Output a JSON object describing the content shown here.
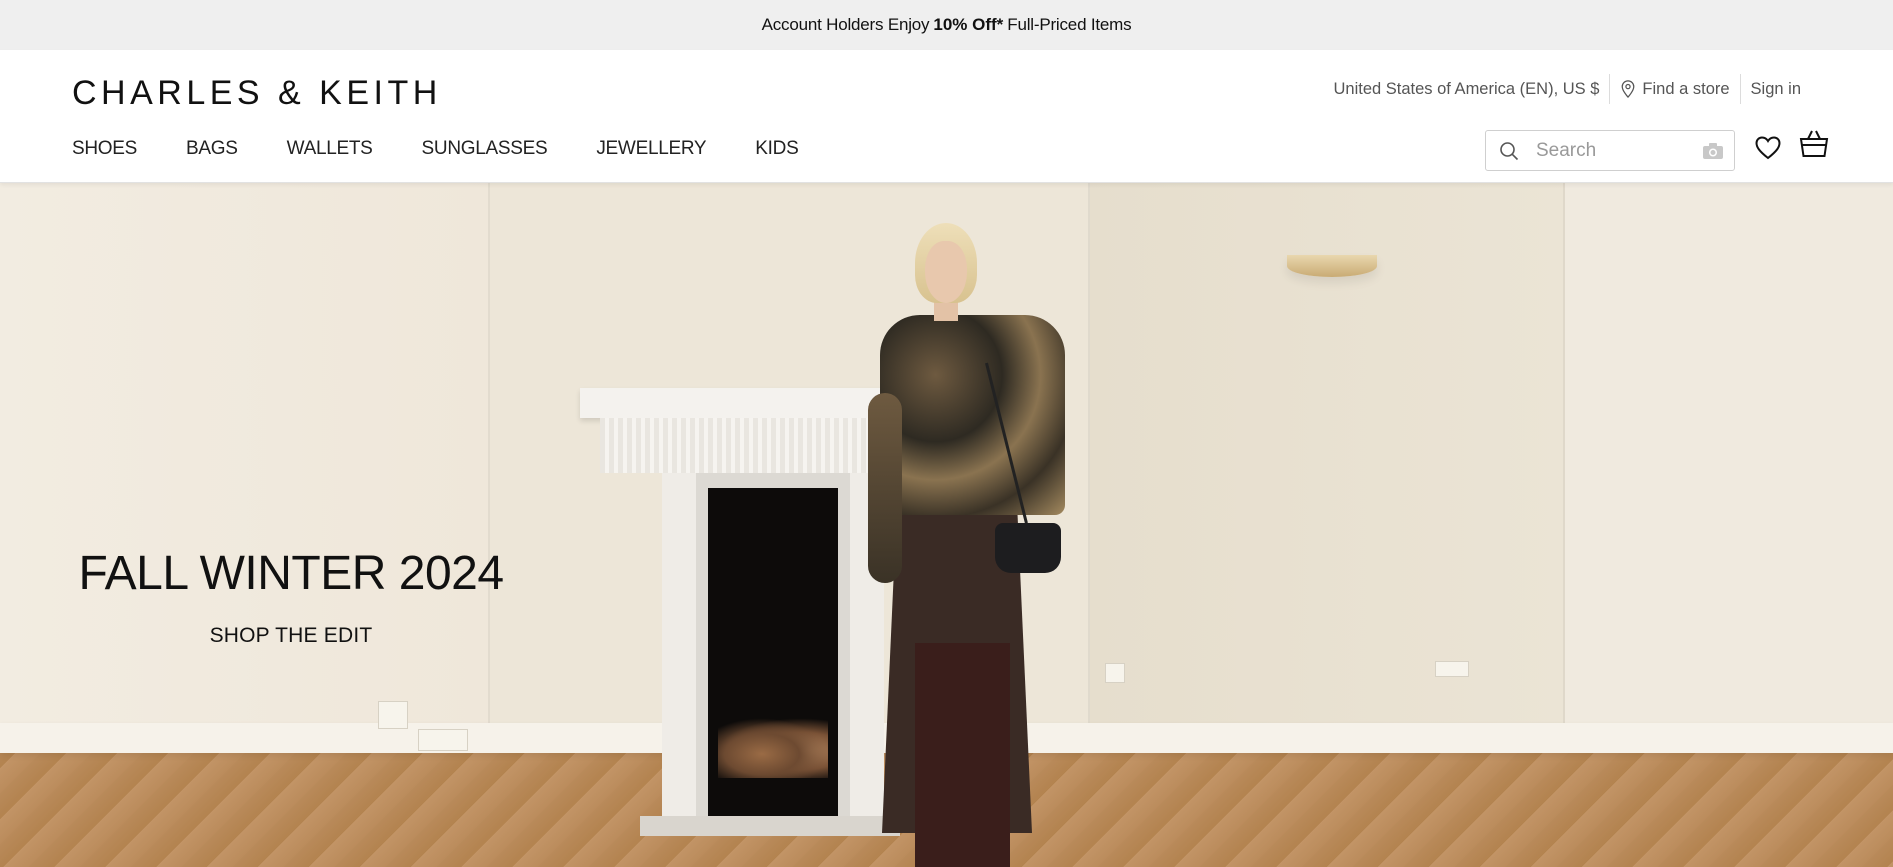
{
  "announcement": {
    "prefix": "Account Holders Enjoy",
    "highlight": "10% Off*",
    "suffix": "Full-Priced Items"
  },
  "header": {
    "logo": "CHARLES & KEITH",
    "region": "United States of America (EN), US $",
    "find_store": "Find a store",
    "sign_in": "Sign in",
    "nav": [
      "SHOES",
      "BAGS",
      "WALLETS",
      "SUNGLASSES",
      "JEWELLERY",
      "KIDS"
    ],
    "search_placeholder": "Search"
  },
  "hero": {
    "title": "FALL WINTER 2024",
    "cta": "SHOP THE EDIT"
  },
  "colors": {
    "announcement_bg": "#efefef",
    "text": "#111111",
    "muted": "#555555"
  },
  "icons": [
    "location-pin-icon",
    "search-icon",
    "camera-icon",
    "heart-icon",
    "shopping-bag-icon"
  ]
}
